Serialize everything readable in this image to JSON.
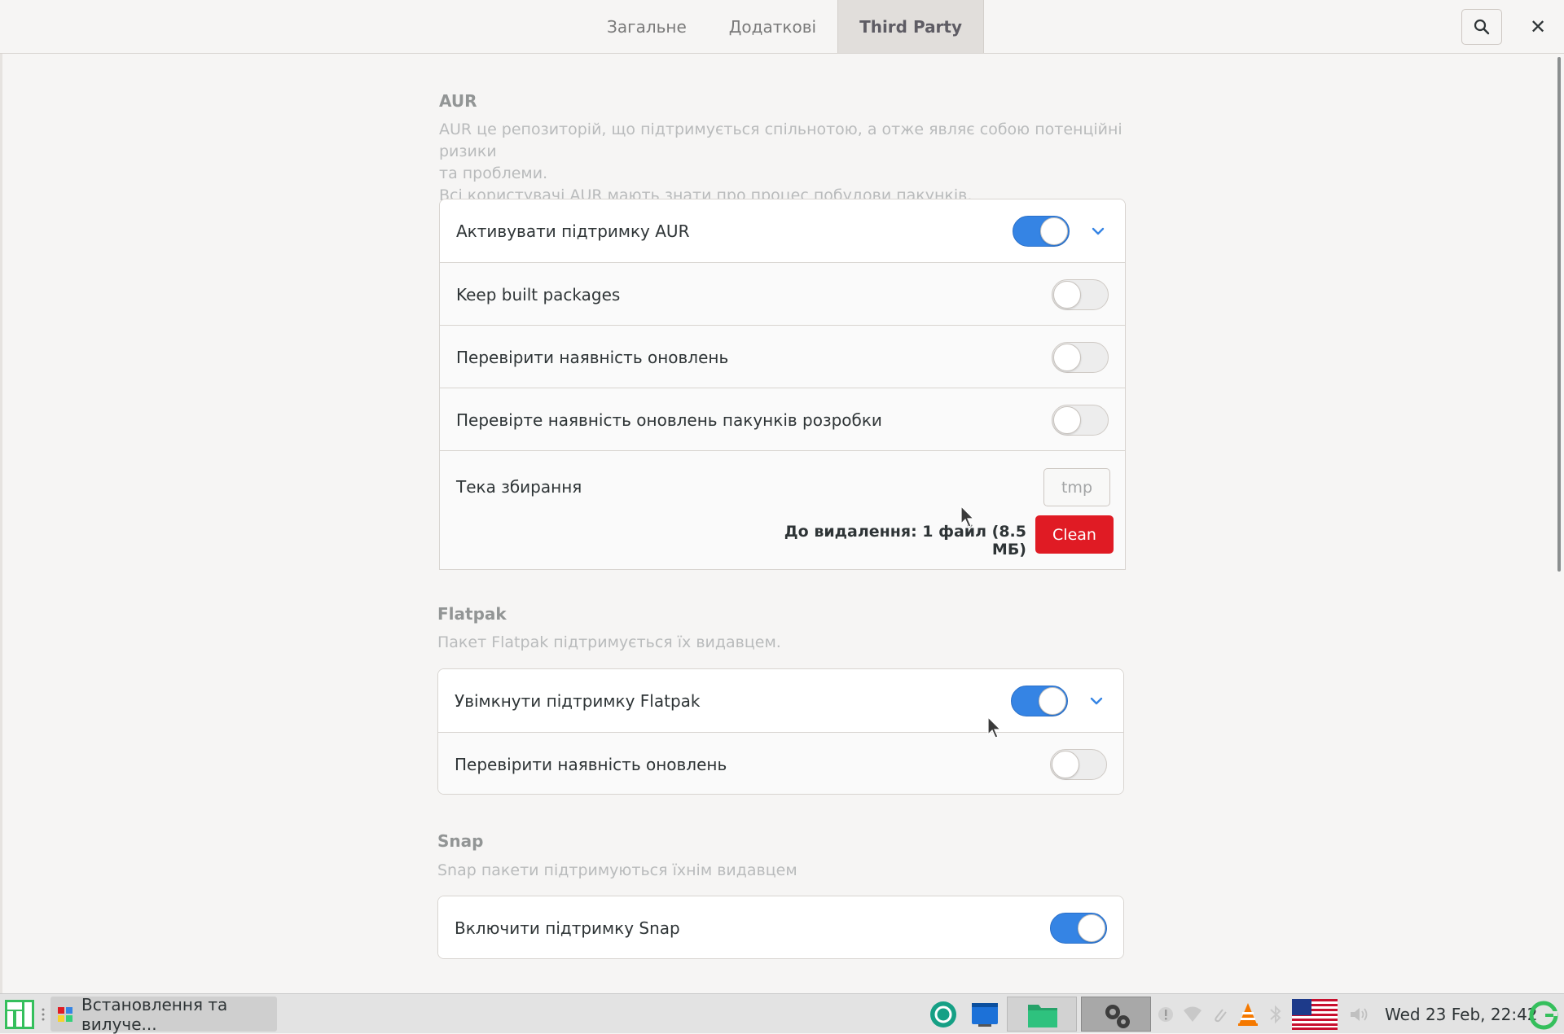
{
  "header": {
    "tabs": [
      {
        "label": "Загальне",
        "active": false
      },
      {
        "label": "Додаткові",
        "active": false
      },
      {
        "label": "Third Party",
        "active": true
      }
    ],
    "search_icon": "search-icon",
    "close_glyph": "✕"
  },
  "aur": {
    "title": "AUR",
    "description_line1": "AUR це репозиторій, що підтримується спільнотою, а отже являє собою потенційні ризики",
    "description_line2": "та проблеми.",
    "description_line3": "Всі користувачі AUR мають знати про процес побудови пакунків.",
    "rows": [
      {
        "label": "Активувати підтримку AUR",
        "on": true,
        "expander": true
      },
      {
        "label": "Keep built packages",
        "on": false
      },
      {
        "label": "Перевірити наявність оновлень",
        "on": false
      },
      {
        "label": "Перевірте наявність оновлень пакунків розробки",
        "on": false
      }
    ],
    "build_dir_label": "Тека збирання",
    "build_dir_value": "tmp",
    "to_delete_label": "До видалення:  1 файл  (8.5 МБ)",
    "clean_label": "Clean"
  },
  "flatpak": {
    "title": "Flatpak",
    "description": "Пакет Flatpak підтримується їх видавцем.",
    "rows": [
      {
        "label": "Увімкнути підтримку Flatpak",
        "on": true,
        "expander": true
      },
      {
        "label": "Перевірити наявність оновлень",
        "on": false
      }
    ]
  },
  "snap": {
    "title": "Snap",
    "description": "Snap пакети підтримуються їхнім видавцем",
    "rows": [
      {
        "label": "Включити підтримку Snap",
        "on": true
      }
    ]
  },
  "taskbar": {
    "task_label": "Встановлення та вилуче...",
    "clock": "Wed 23 Feb, 22:42"
  },
  "colors": {
    "accent": "#3584e4",
    "destructive": "#e01b24"
  }
}
